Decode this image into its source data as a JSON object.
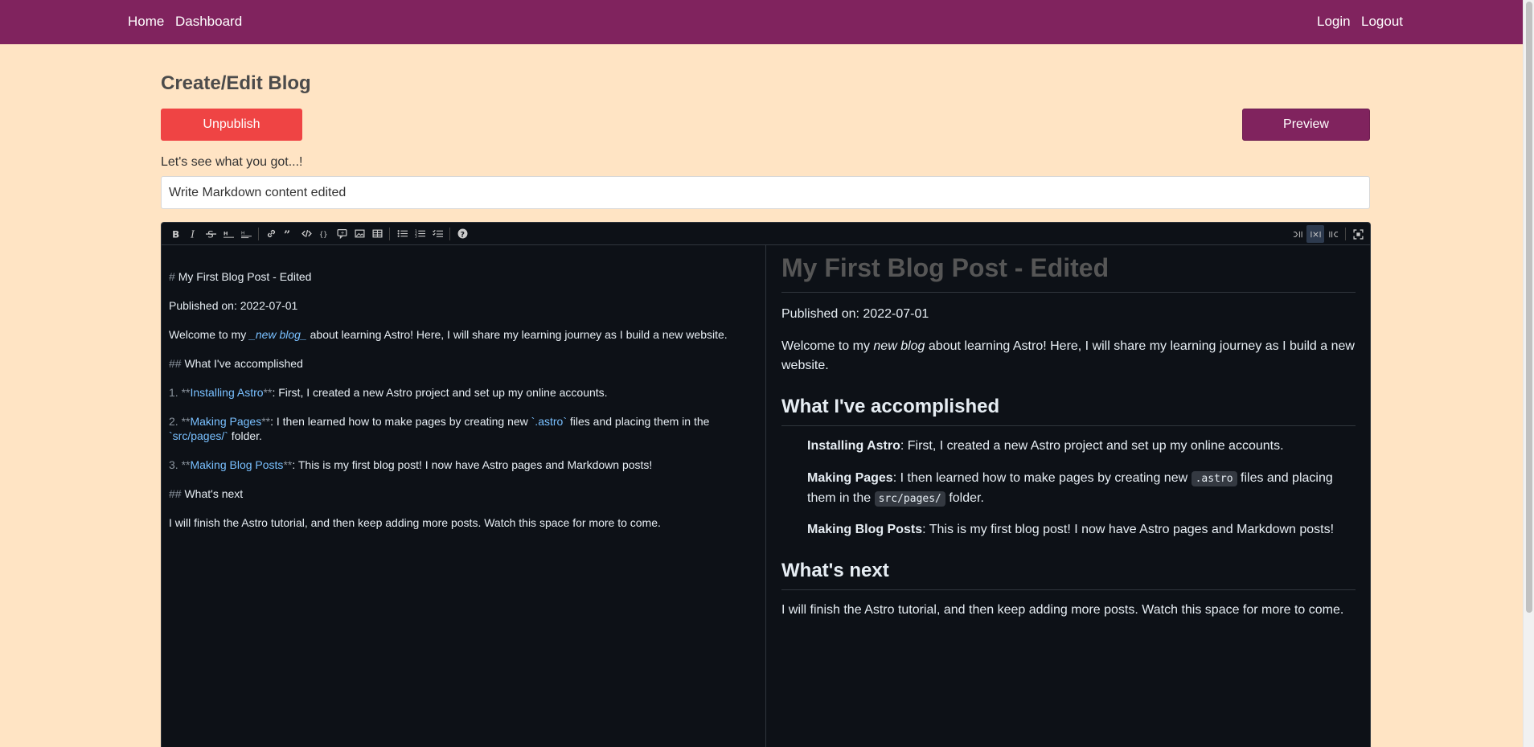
{
  "nav": {
    "home": "Home",
    "dashboard": "Dashboard",
    "login": "Login",
    "logout": "Logout"
  },
  "page": {
    "title": "Create/Edit Blog",
    "unpublish_label": "Unpublish",
    "preview_label": "Preview",
    "field_label": "Let's see what you got...!",
    "title_value": "Write Markdown content edited"
  },
  "toolbar": {
    "left": [
      "bold-icon",
      "italic-icon",
      "strikethrough-icon",
      "heading-icon",
      "heading-smaller-icon",
      "link-icon",
      "quote-icon",
      "code-icon",
      "code-block-icon",
      "comment-icon",
      "image-icon",
      "table-icon",
      "unordered-list-icon",
      "ordered-list-icon",
      "task-list-icon",
      "help-icon"
    ],
    "right": [
      "edit-mode-icon",
      "side-by-side-icon",
      "preview-mode-icon",
      "fullscreen-icon"
    ]
  },
  "source": {
    "l1_mark": "#",
    "l1_text": "My First Blog Post - Edited",
    "l2": "Published on: 2022-07-01",
    "l3_pre": "Welcome to my ",
    "l3_em": "_new blog_",
    "l3_post": " about learning Astro! Here, I will share my learning journey as I build a new website.",
    "l4_mark": "##",
    "l4_text": "What I've accomplished",
    "l5_num": "1.",
    "l5_open": "**",
    "l5_bold": "Installing Astro",
    "l5_close": "**",
    "l5_rest": ": First, I created a new Astro project and set up my online accounts.",
    "l6_num": "2.",
    "l6_open": "**",
    "l6_bold": "Making Pages",
    "l6_close": "**",
    "l6_rest": ": I then learned how to make pages by creating new ",
    "l6_code": "`.astro`",
    "l6_rest2": " files and placing them in the",
    "l6b_code": "`src/pages/`",
    "l6b_rest": " folder.",
    "l7_num": "3.",
    "l7_open": "**",
    "l7_bold": "Making Blog Posts",
    "l7_close": "**",
    "l7_rest": ": This is my first blog post! I now have Astro pages and Markdown posts!",
    "l8_mark": "##",
    "l8_text": "What's next",
    "l9": "I will finish the Astro tutorial, and then keep adding more posts. Watch this space for more to come."
  },
  "preview": {
    "h1": "My First Blog Post - Edited",
    "published": "Published on: 2022-07-01",
    "welcome_pre": "Welcome to my ",
    "welcome_em": "new blog",
    "welcome_post": " about learning Astro! Here, I will share my learning journey as I build a new website.",
    "h2_accomplished": "What I've accomplished",
    "item1_bold": "Installing Astro",
    "item1_rest": ": First, I created a new Astro project and set up my online accounts.",
    "item2_bold": "Making Pages",
    "item2_rest": ": I then learned how to make pages by creating new ",
    "item2_code1": ".astro",
    "item2_mid": " files and placing them in the ",
    "item2_code2": "src/pages/",
    "item2_end": " folder.",
    "item3_bold": "Making Blog Posts",
    "item3_rest": ": This is my first blog post! I now have Astro pages and Markdown posts!",
    "h2_next": "What's next",
    "closing": "I will finish the Astro tutorial, and then keep adding more posts. Watch this space for more to come."
  },
  "colors": {
    "brand": "#80235e",
    "danger": "#ef4444",
    "background": "#ffe4c4",
    "editor_bg": "#0d1117"
  }
}
